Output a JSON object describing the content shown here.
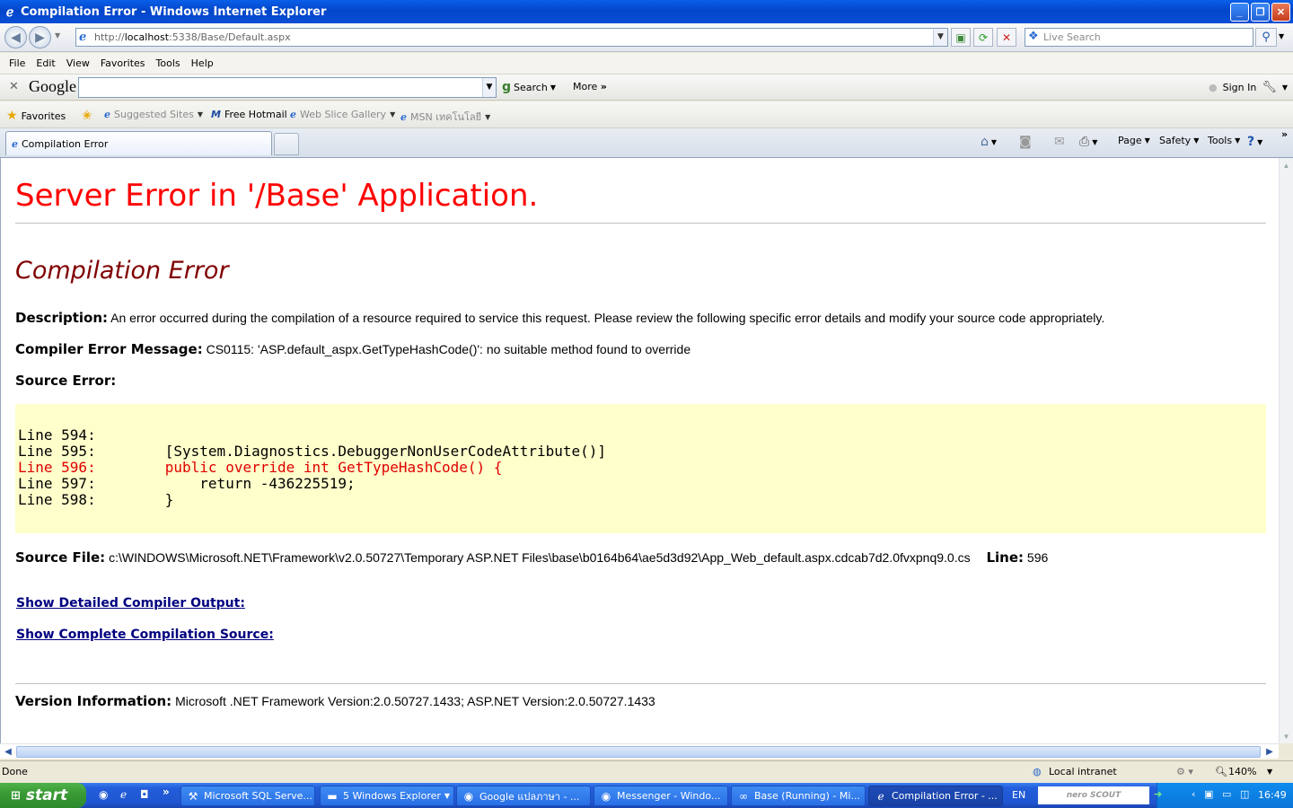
{
  "window": {
    "title": "Compilation Error - Windows Internet Explorer",
    "controls": {
      "minimize": "_",
      "restore": "❐",
      "close": "✕"
    }
  },
  "address": {
    "prefix": "http://",
    "host": "localhost",
    "path": ":5338/Base/Default.aspx",
    "live_search_placeholder": "Live Search"
  },
  "menu": [
    "File",
    "Edit",
    "View",
    "Favorites",
    "Tools",
    "Help"
  ],
  "google_toolbar": {
    "logo": "Google",
    "search_label": "Search",
    "more_label": "More",
    "sign_in": "Sign In"
  },
  "favorites_bar": {
    "favorites_label": "Favorites",
    "items": [
      "Suggested Sites",
      "Free Hotmail",
      "Web Slice Gallery",
      "MSN เทคโนโลยี"
    ]
  },
  "tab": {
    "title": "Compilation Error"
  },
  "command_bar": {
    "page": "Page",
    "safety": "Safety",
    "tools": "Tools"
  },
  "error_page": {
    "heading": "Server Error in '/Base' Application.",
    "subheading": "Compilation Error",
    "description_label": "Description:",
    "description_text": "An error occurred during the compilation of a resource required to service this request. Please review the following specific error details and modify your source code appropriately.",
    "compiler_label": "Compiler Error Message:",
    "compiler_text": "CS0115: 'ASP.default_aspx.GetTypeHashCode()': no suitable method found to override",
    "source_error_label": "Source Error:",
    "code_lines": [
      {
        "text": "Line 594:",
        "error": false
      },
      {
        "text": "Line 595:        [System.Diagnostics.DebuggerNonUserCodeAttribute()]",
        "error": false
      },
      {
        "text": "Line 596:        public override int GetTypeHashCode() {",
        "error": true
      },
      {
        "text": "Line 597:            return -436225519;",
        "error": false
      },
      {
        "text": "Line 598:        }",
        "error": false
      }
    ],
    "source_file_label": "Source File:",
    "source_file_path": "c:\\WINDOWS\\Microsoft.NET\\Framework\\v2.0.50727\\Temporary ASP.NET Files\\base\\b0164b64\\ae5d3d92\\App_Web_default.aspx.cdcab7d2.0fvxpnq9.0.cs",
    "line_label": "Line:",
    "line_value": "596",
    "link_compiler_output": "Show Detailed Compiler Output:",
    "link_compilation_source": "Show Complete Compilation Source:",
    "version_label": "Version Information:",
    "version_text": "Microsoft .NET Framework Version:2.0.50727.1433; ASP.NET Version:2.0.50727.1433"
  },
  "status_bar": {
    "left": "Done",
    "zone": "Local intranet",
    "zoom": "140%"
  },
  "taskbar": {
    "start": "start",
    "tasks": [
      {
        "label": "Microsoft SQL Serve...",
        "active": false
      },
      {
        "label": "5 Windows Explorer",
        "active": false
      },
      {
        "label": "Google แปลภาษา - ...",
        "active": false
      },
      {
        "label": "Messenger - Windo...",
        "active": false
      },
      {
        "label": "Base (Running) - Mi...",
        "active": false
      },
      {
        "label": "Compilation Error - ...",
        "active": true
      }
    ],
    "language": "EN",
    "nero_label": "nero SCOUT",
    "clock": "16:49"
  }
}
